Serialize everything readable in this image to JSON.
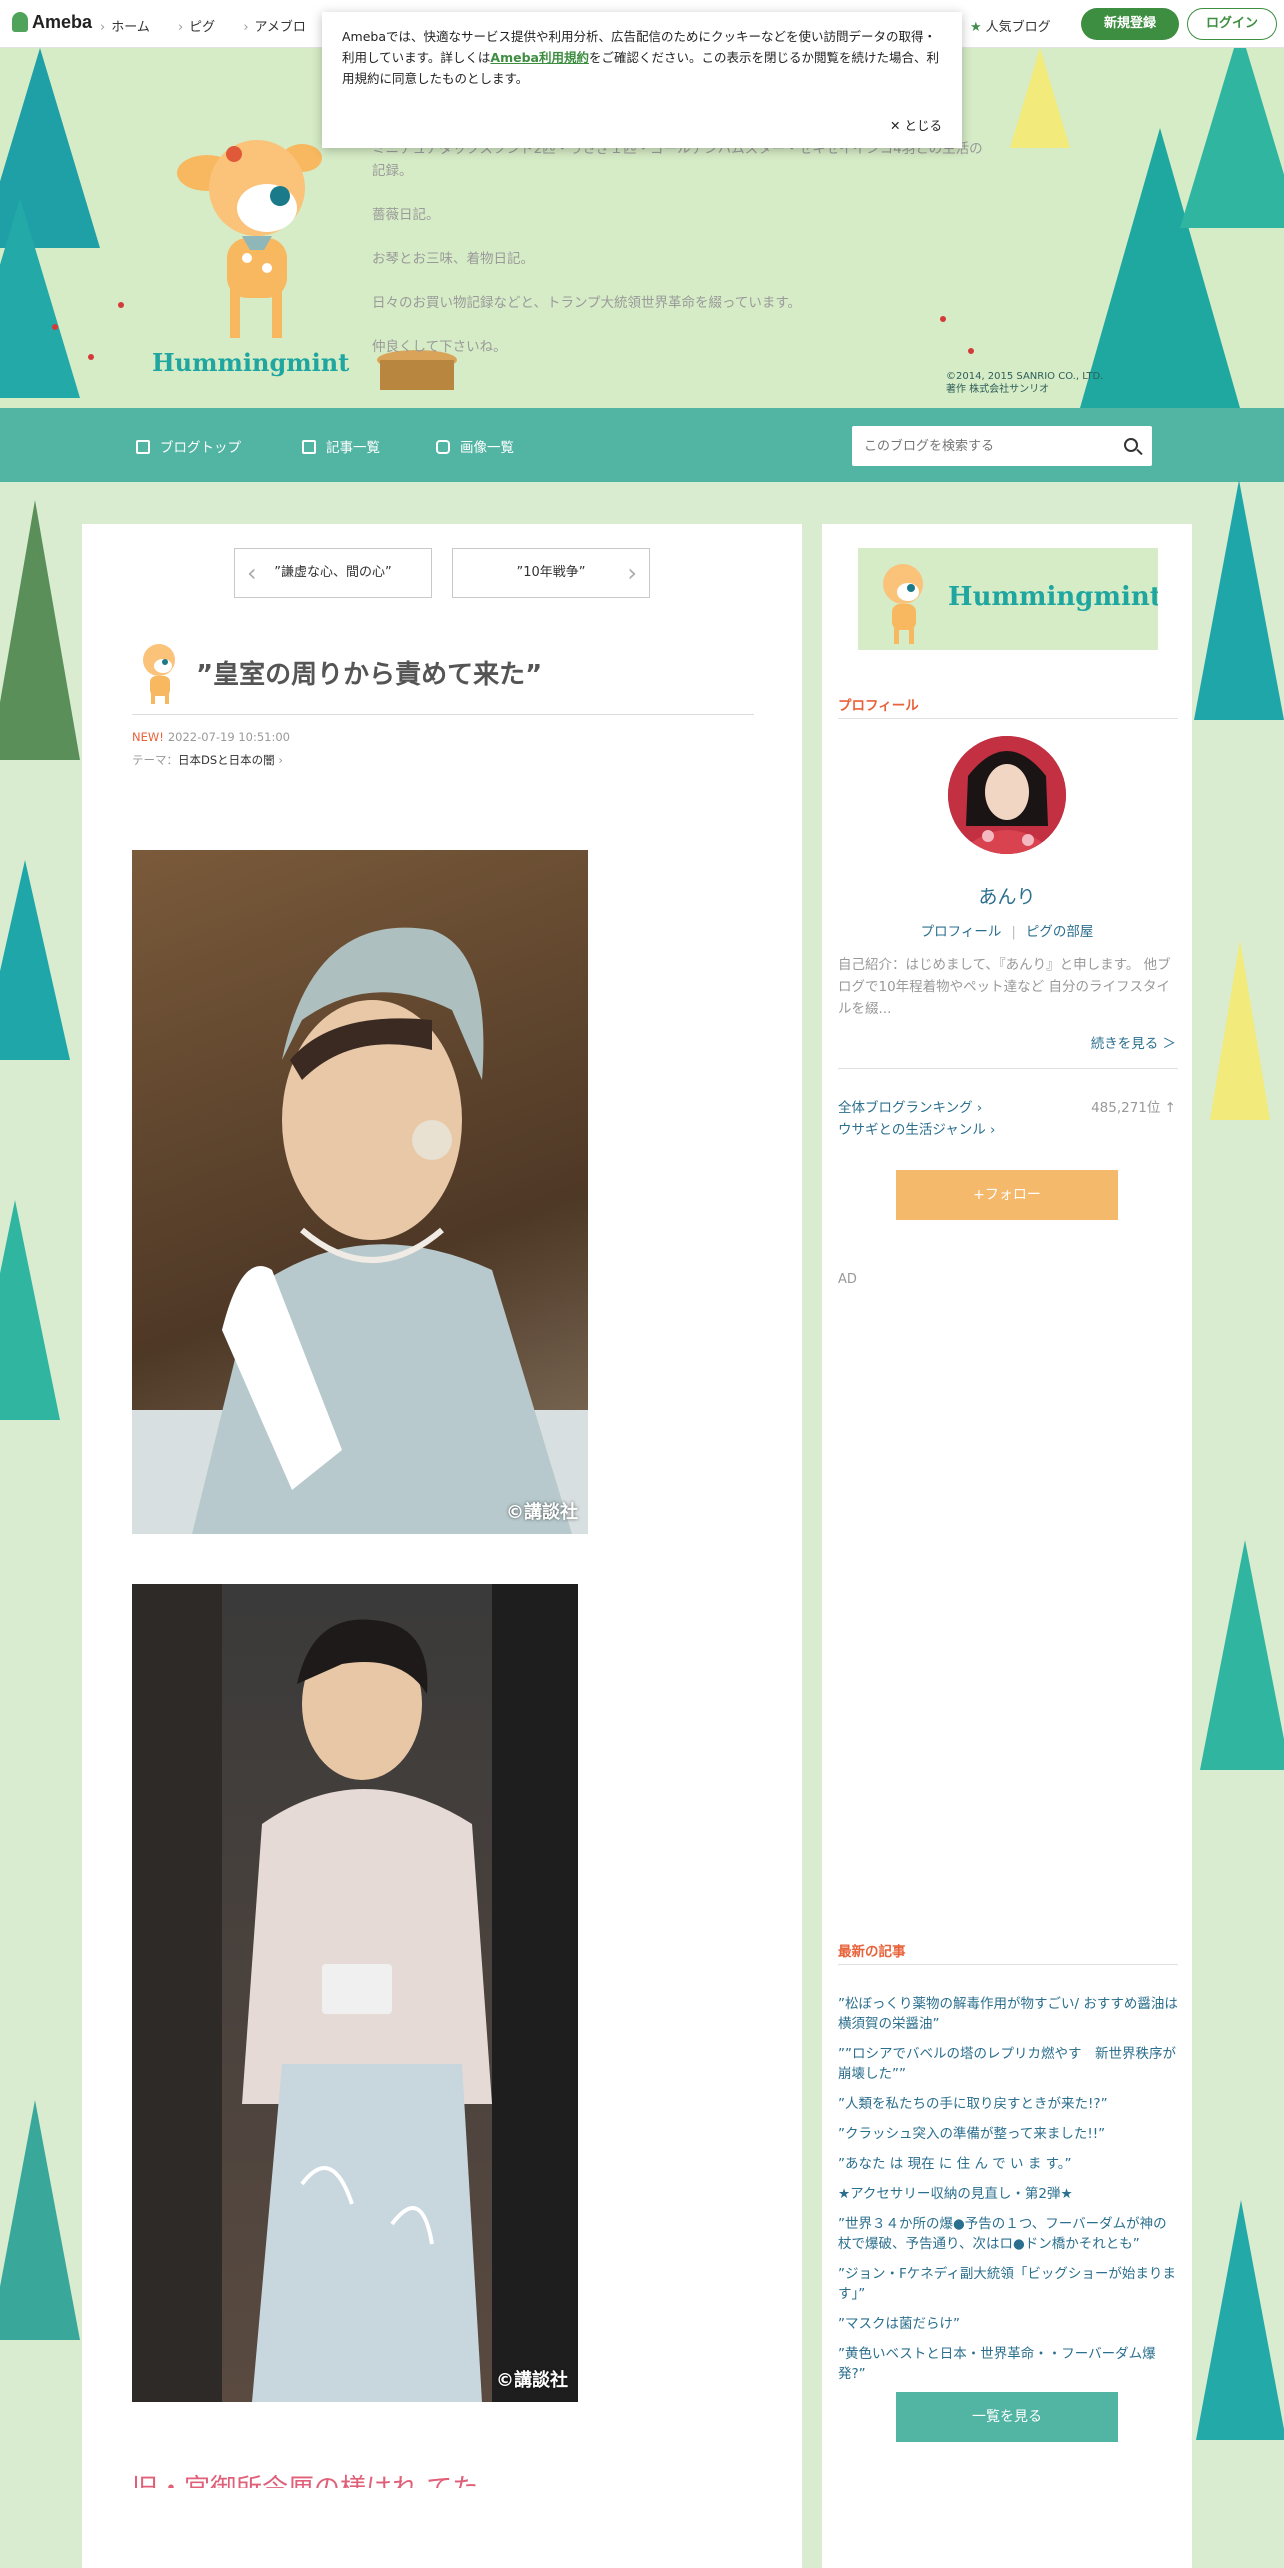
{
  "global_bar": {
    "logo": "Ameba",
    "nav": [
      "ホーム",
      "ピグ",
      "アメブロ"
    ],
    "popular": "人気ブログ",
    "register": "新規登録",
    "login": "ログイン"
  },
  "cookie": {
    "text_before_link": "Amebaでは、快適なサービス提供や利用分析、広告配信のためにクッキーなどを使い訪問データの取得・利用しています。詳しくは",
    "link": "Ameba利用規約",
    "text_after_link": "をご確認ください。この表示を閉じるか閲覧を続けた場合、利用規約に同意したものとします。",
    "close": "とじる"
  },
  "header": {
    "desc": [
      "ミニチュアダックスフンド2匹・うさぎ１匹・ゴールデンハムスター・セキセイインコ4羽との生活の記録。",
      "薔薇日記。",
      "お琴とお三味、着物日記。",
      "日々のお買い物記録などと、トランプ大統領世界革命を綴っています。",
      "仲良くして下さいね。"
    ],
    "logo_text": "Hummingmint",
    "copyright_line1": "©2014, 2015 SANRIO CO., LTD.",
    "copyright_line2": "著作 株式会社サンリオ"
  },
  "navbar": {
    "items": [
      "ブログトップ",
      "記事一覧",
      "画像一覧"
    ],
    "search_placeholder": "このブログを検索する"
  },
  "entry": {
    "prev": "”謙虚な心、間の心”",
    "next": "”10年戦争”",
    "title": "”皇室の周りから責めて来た”",
    "new_badge": "NEW!",
    "date": "2022-07-19 10:51:00",
    "theme_label": "テーマ：",
    "theme": "日本DSと日本の闇",
    "photo_credit_1": "©講談社",
    "photo_credit_2": "©講談社",
    "next_heading": "旧・宮御所令厘の様はれ てた"
  },
  "sidebar": {
    "banner_text": "Hummingmint",
    "profile_heading": "プロフィール",
    "name": "あんり",
    "profile_link": "プロフィール",
    "pig_link": "ピグの部屋",
    "intro": "自己紹介：はじめまして、『あんり』と申します。 他ブログで10年程着物やペット達など 自分のライフスタイルを綴...",
    "more": "続きを見る ＞",
    "ranking_all": "全体ブログランキング",
    "ranking_value": "485,271位 ↑",
    "ranking_genre": "ウサギとの生活ジャンル",
    "follow": "+フォロー",
    "ad": "AD",
    "latest_heading": "最新の記事",
    "articles": [
      "”松ぼっくり薬物の解毒作用が物すごい/ おすすめ醤油は横須賀の栄醤油”",
      "””ロシアでバベルの塔のレプリカ燃やす　新世界秩序が崩壊した””",
      "”人類を私たちの手に取り戻すときが来た!?”",
      "”クラッシュ突入の準備が整って来ました!!”",
      "”あなた は 現在 に 住 ん で い ま す。”",
      "★アクセサリー収納の見直し・第2弾★",
      "”世界３４か所の爆●予告の１つ、フーバーダムが神の杖で爆破、予告通り、次はロ●ドン橋かそれとも”",
      "”ジョン・Fケネディ副大統領「ビッグショーが始まります」”",
      "”マスクは菌だらけ”",
      "”黄色いベストと日本・世界革命・・フーバーダム爆発?”"
    ],
    "list_button": "一覧を見る"
  },
  "colors": {
    "accent_green": "#3e8e41",
    "nav_teal": "#52b4a3",
    "heading_orange": "#e8623a",
    "link_blue": "#2b6f8e",
    "follow_orange": "#f5b96b"
  }
}
